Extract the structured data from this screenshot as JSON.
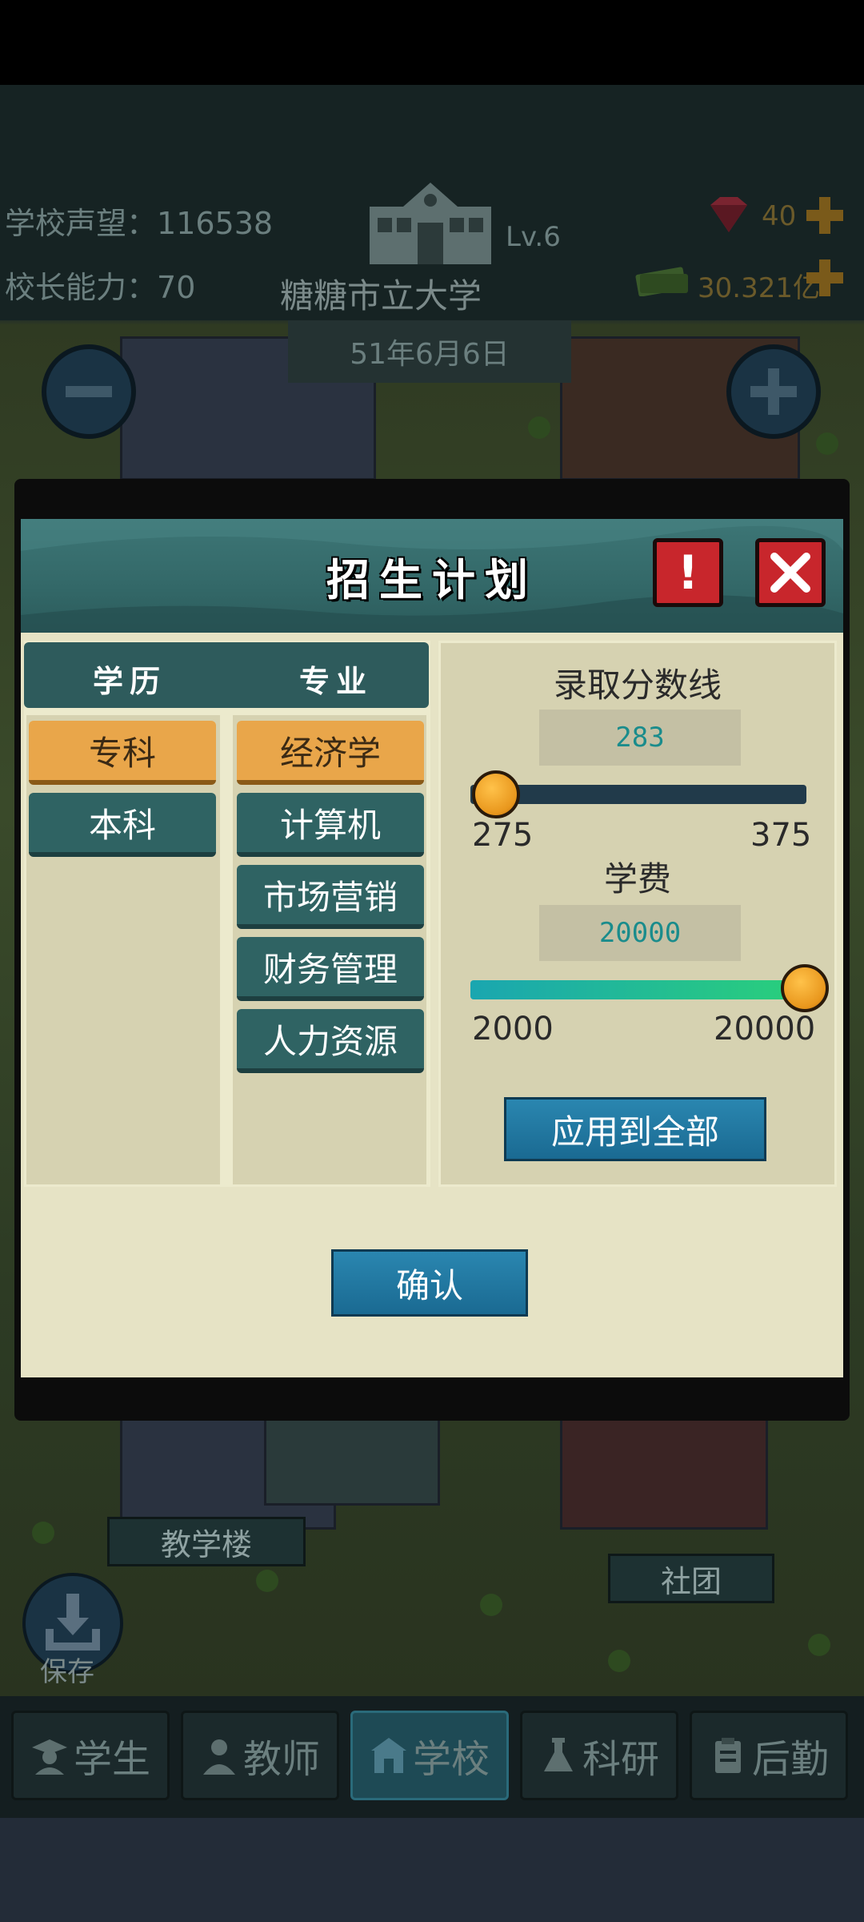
{
  "hud": {
    "reputation_label": "学校声望：",
    "reputation_value": "116538",
    "ability_label": "校长能力：",
    "ability_value": "70",
    "level": "Lv.6",
    "school_name": "糖糖市立大学",
    "date": "51年6月6日",
    "gems": "40",
    "cash": "30.321亿"
  },
  "dialog": {
    "title": "招生计划",
    "help_symbol": "!",
    "columns": {
      "education": "学历",
      "major": "专业"
    },
    "education_levels": [
      {
        "label": "专科",
        "selected": true
      },
      {
        "label": "本科",
        "selected": false
      }
    ],
    "majors": [
      {
        "label": "经济学",
        "selected": true
      },
      {
        "label": "计算机",
        "selected": false
      },
      {
        "label": "市场营销",
        "selected": false
      },
      {
        "label": "财务管理",
        "selected": false
      },
      {
        "label": "人力资源",
        "selected": false
      }
    ],
    "cutoff": {
      "label": "录取分数线",
      "value": "283",
      "min": "275",
      "max": "375"
    },
    "tuition": {
      "label": "学费",
      "value": "20000",
      "min": "2000",
      "max": "20000"
    },
    "apply_all_label": "应用到全部",
    "confirm_label": "确认"
  },
  "map_labels": {
    "teaching_building": "教学楼",
    "club": "社团"
  },
  "save_label": "保存",
  "nav": [
    {
      "label": "学生",
      "icon": "student-icon",
      "active": false
    },
    {
      "label": "教师",
      "icon": "teacher-icon",
      "active": false
    },
    {
      "label": "学校",
      "icon": "school-icon",
      "active": true
    },
    {
      "label": "科研",
      "icon": "flask-icon",
      "active": false
    },
    {
      "label": "后勤",
      "icon": "clipboard-icon",
      "active": false
    }
  ],
  "colors": {
    "teal": "#2f6363",
    "orange": "#e9a64a",
    "red": "#c8262c",
    "blue_button": "#1a6a92",
    "panel": "#e6e3c5"
  }
}
